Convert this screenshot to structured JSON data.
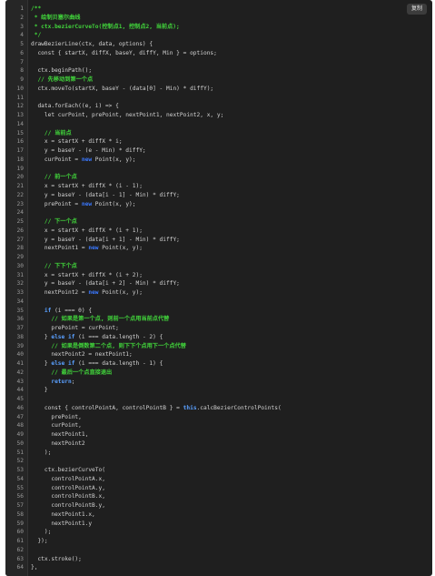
{
  "copy_button": {
    "label": "复制"
  },
  "code_lines": [
    {
      "n": "1",
      "segs": [
        {
          "t": "/**",
          "c": "cm"
        }
      ]
    },
    {
      "n": "2",
      "segs": [
        {
          "t": " * 绘制贝塞尔曲线",
          "c": "cm"
        }
      ]
    },
    {
      "n": "3",
      "segs": [
        {
          "t": " * ctx.bezierCurveTo(控制点1, 控制点2, 当前点);",
          "c": "cm"
        }
      ]
    },
    {
      "n": "4",
      "segs": [
        {
          "t": " */",
          "c": "cm"
        }
      ]
    },
    {
      "n": "5",
      "segs": [
        {
          "t": "drawBezierLine(ctx, data, options) {"
        }
      ]
    },
    {
      "n": "6",
      "segs": [
        {
          "t": "  const { startX, diffX, baseY, diffY, Min } = options;"
        }
      ]
    },
    {
      "n": "7",
      "segs": [
        {
          "t": ""
        }
      ]
    },
    {
      "n": "8",
      "segs": [
        {
          "t": "  ctx.beginPath();"
        }
      ]
    },
    {
      "n": "9",
      "segs": [
        {
          "t": "  // 先移动到第一个点",
          "c": "cm"
        }
      ]
    },
    {
      "n": "10",
      "segs": [
        {
          "t": "  ctx.moveTo(startX, baseY - (data[0] - Min) * diffY);"
        }
      ]
    },
    {
      "n": "11",
      "segs": [
        {
          "t": ""
        }
      ]
    },
    {
      "n": "12",
      "segs": [
        {
          "t": "  data.forEach((e, i) => {"
        }
      ]
    },
    {
      "n": "13",
      "segs": [
        {
          "t": "    let curPoint, prePoint, nextPoint1, nextPoint2, x, y;"
        }
      ]
    },
    {
      "n": "14",
      "segs": [
        {
          "t": ""
        }
      ]
    },
    {
      "n": "15",
      "segs": [
        {
          "t": "    // 当前点",
          "c": "cm"
        }
      ]
    },
    {
      "n": "16",
      "segs": [
        {
          "t": "    x = startX + diffX * i;"
        }
      ]
    },
    {
      "n": "17",
      "segs": [
        {
          "t": "    y = baseY - (e - Min) * diffY;"
        }
      ]
    },
    {
      "n": "18",
      "segs": [
        {
          "t": "    curPoint = "
        },
        {
          "t": "new",
          "c": "kn"
        },
        {
          "t": " Point(x, y);"
        }
      ]
    },
    {
      "n": "19",
      "segs": [
        {
          "t": ""
        }
      ]
    },
    {
      "n": "20",
      "segs": [
        {
          "t": "    // 前一个点",
          "c": "cm"
        }
      ]
    },
    {
      "n": "21",
      "segs": [
        {
          "t": "    x = startX + diffX * (i - 1);"
        }
      ]
    },
    {
      "n": "22",
      "segs": [
        {
          "t": "    y = baseY - (data[i - 1] - Min) * diffY;"
        }
      ]
    },
    {
      "n": "23",
      "segs": [
        {
          "t": "    prePoint = "
        },
        {
          "t": "new",
          "c": "kn"
        },
        {
          "t": " Point(x, y);"
        }
      ]
    },
    {
      "n": "24",
      "segs": [
        {
          "t": ""
        }
      ]
    },
    {
      "n": "25",
      "segs": [
        {
          "t": "    // 下一个点",
          "c": "cm"
        }
      ]
    },
    {
      "n": "26",
      "segs": [
        {
          "t": "    x = startX + diffX * (i + 1);"
        }
      ]
    },
    {
      "n": "27",
      "segs": [
        {
          "t": "    y = baseY - (data[i + 1] - Min) * diffY;"
        }
      ]
    },
    {
      "n": "28",
      "segs": [
        {
          "t": "    nextPoint1 = "
        },
        {
          "t": "new",
          "c": "kn"
        },
        {
          "t": " Point(x, y);"
        }
      ]
    },
    {
      "n": "29",
      "segs": [
        {
          "t": ""
        }
      ]
    },
    {
      "n": "30",
      "segs": [
        {
          "t": "    // 下下个点",
          "c": "cm"
        }
      ]
    },
    {
      "n": "31",
      "segs": [
        {
          "t": "    x = startX + diffX * (i + 2);"
        }
      ]
    },
    {
      "n": "32",
      "segs": [
        {
          "t": "    y = baseY - (data[i + 2] - Min) * diffY;"
        }
      ]
    },
    {
      "n": "33",
      "segs": [
        {
          "t": "    nextPoint2 = "
        },
        {
          "t": "new",
          "c": "kn"
        },
        {
          "t": " Point(x, y);"
        }
      ]
    },
    {
      "n": "34",
      "segs": [
        {
          "t": ""
        }
      ]
    },
    {
      "n": "35",
      "segs": [
        {
          "t": "    "
        },
        {
          "t": "if",
          "c": "kw"
        },
        {
          "t": " (i === 0) {"
        }
      ]
    },
    {
      "n": "36",
      "segs": [
        {
          "t": "      // 如果是第一个点, 则前一个点用当前点代替",
          "c": "cm"
        }
      ]
    },
    {
      "n": "37",
      "segs": [
        {
          "t": "      prePoint = curPoint;"
        }
      ]
    },
    {
      "n": "38",
      "segs": [
        {
          "t": "    } "
        },
        {
          "t": "else if",
          "c": "kw"
        },
        {
          "t": " (i === data.length - 2) {"
        }
      ]
    },
    {
      "n": "39",
      "segs": [
        {
          "t": "      // 如果是倒数第二个点, 则下下个点用下一个点代替",
          "c": "cm"
        }
      ]
    },
    {
      "n": "40",
      "segs": [
        {
          "t": "      nextPoint2 = nextPoint1;"
        }
      ]
    },
    {
      "n": "41",
      "segs": [
        {
          "t": "    } "
        },
        {
          "t": "else if",
          "c": "kw"
        },
        {
          "t": " (i === data.length - 1) {"
        }
      ]
    },
    {
      "n": "42",
      "segs": [
        {
          "t": "      // 最后一个点直接退出",
          "c": "cm"
        }
      ]
    },
    {
      "n": "43",
      "segs": [
        {
          "t": "      "
        },
        {
          "t": "return",
          "c": "kw"
        },
        {
          "t": ";"
        }
      ]
    },
    {
      "n": "44",
      "segs": [
        {
          "t": "    }"
        }
      ]
    },
    {
      "n": "45",
      "segs": [
        {
          "t": ""
        }
      ]
    },
    {
      "n": "46",
      "segs": [
        {
          "t": "    const { controlPointA, controlPointB } = "
        },
        {
          "t": "this",
          "c": "kw"
        },
        {
          "t": ".calcBezierControlPoints("
        }
      ]
    },
    {
      "n": "47",
      "segs": [
        {
          "t": "      prePoint,"
        }
      ]
    },
    {
      "n": "48",
      "segs": [
        {
          "t": "      curPoint,"
        }
      ]
    },
    {
      "n": "49",
      "segs": [
        {
          "t": "      nextPoint1,"
        }
      ]
    },
    {
      "n": "50",
      "segs": [
        {
          "t": "      nextPoint2"
        }
      ]
    },
    {
      "n": "51",
      "segs": [
        {
          "t": "    );"
        }
      ]
    },
    {
      "n": "52",
      "segs": [
        {
          "t": ""
        }
      ]
    },
    {
      "n": "53",
      "segs": [
        {
          "t": "    ctx.bezierCurveTo("
        }
      ]
    },
    {
      "n": "54",
      "segs": [
        {
          "t": "      controlPointA.x,"
        }
      ]
    },
    {
      "n": "55",
      "segs": [
        {
          "t": "      controlPointA.y,"
        }
      ]
    },
    {
      "n": "56",
      "segs": [
        {
          "t": "      controlPointB.x,"
        }
      ]
    },
    {
      "n": "57",
      "segs": [
        {
          "t": "      controlPointB.y,"
        }
      ]
    },
    {
      "n": "58",
      "segs": [
        {
          "t": "      nextPoint1.x,"
        }
      ]
    },
    {
      "n": "59",
      "segs": [
        {
          "t": "      nextPoint1.y"
        }
      ]
    },
    {
      "n": "60",
      "segs": [
        {
          "t": "    );"
        }
      ]
    },
    {
      "n": "61",
      "segs": [
        {
          "t": "  });"
        }
      ]
    },
    {
      "n": "62",
      "segs": [
        {
          "t": ""
        }
      ]
    },
    {
      "n": "63",
      "segs": [
        {
          "t": "  ctx.stroke();"
        }
      ]
    },
    {
      "n": "64",
      "segs": [
        {
          "t": "},"
        }
      ]
    }
  ]
}
